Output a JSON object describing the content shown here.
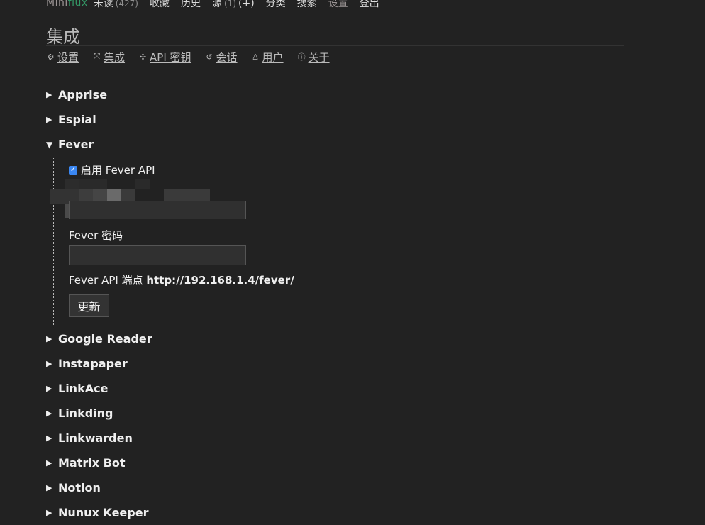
{
  "logo": {
    "mini": "Mini",
    "flux": "flux"
  },
  "top_nav": {
    "unread": {
      "label": "未读",
      "count": "(427)"
    },
    "starred": "收藏",
    "history": "历史",
    "feeds": {
      "label": "源",
      "count": "(1)",
      "add": "(+)"
    },
    "categories": "分类",
    "search": "搜索",
    "settings": "设置",
    "logout": "登出"
  },
  "page_title": "集成",
  "sub_nav": [
    {
      "icon": "gear-icon",
      "label": "设置"
    },
    {
      "icon": "integration-icon",
      "label": "集成"
    },
    {
      "icon": "api-key-icon",
      "label": "API 密钥"
    },
    {
      "icon": "session-icon",
      "label": "会话"
    },
    {
      "icon": "users-icon",
      "label": "用户"
    },
    {
      "icon": "info-icon",
      "label": "关于"
    }
  ],
  "sections_before": [
    "Apprise",
    "Espial"
  ],
  "fever": {
    "title": "Fever",
    "enable_label": "启用 Fever API",
    "enabled": true,
    "username_value": "",
    "password_label": "Fever 密码",
    "password_value": "",
    "endpoint_label": "Fever API 端点",
    "endpoint_url": "http://192.168.1.4/fever/",
    "update_button": "更新"
  },
  "sections_after": [
    "Google Reader",
    "Instapaper",
    "LinkAce",
    "Linkding",
    "Linkwarden",
    "Matrix Bot",
    "Notion",
    "Nunux Keeper"
  ],
  "colors": {
    "background": "#222222",
    "accent_flux": "#339966",
    "checkbox": "#3a87f3"
  }
}
